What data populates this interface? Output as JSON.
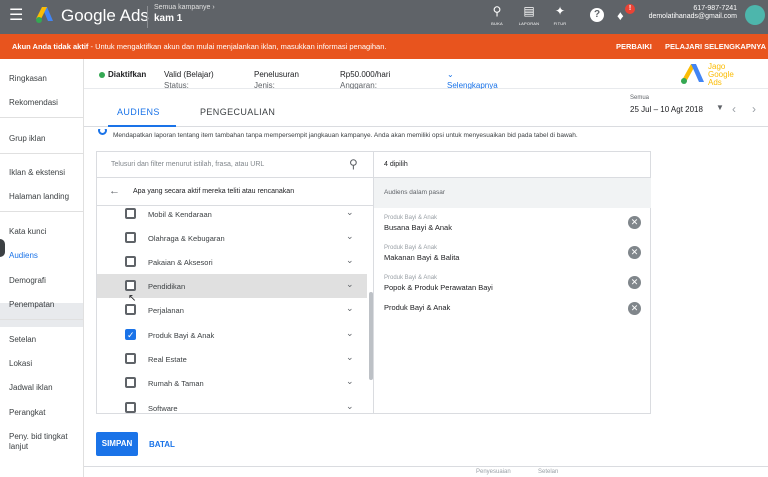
{
  "topbar": {
    "app_name": "Google Ads",
    "crumb_parent": "Semua kampanye",
    "crumb_current": "kam 1",
    "tools": [
      {
        "icon": "search-icon",
        "label": "BUKA"
      },
      {
        "icon": "bar-chart-icon",
        "label": "LAPORAN"
      },
      {
        "icon": "wrench-icon",
        "label": "FITUR"
      }
    ],
    "notif_badge": "!",
    "account_phone": "617-987-7241",
    "account_email": "demolatihanads@gmail.com"
  },
  "alert": {
    "bold": "Akun Anda tidak aktif",
    "text": " - Untuk mengaktifkan akun dan mulai menjalankan iklan, masukkan informasi penagihan.",
    "action1": "PERBAIKI",
    "action2": "PELAJARI SELENGKAPNYA",
    "color": "#e8541e"
  },
  "sidebar": {
    "items": [
      "Ringkasan",
      "Rekomendasi",
      "Grup iklan",
      "Iklan & ekstensi",
      "Halaman landing",
      "Kata kunci",
      "Audiens",
      "Demografi",
      "Penempatan",
      "Setelan",
      "Lokasi",
      "Jadwal iklan",
      "Perangkat",
      "Peny. bid tingkat lanjut"
    ],
    "active": "Audiens"
  },
  "status": {
    "state": "Diaktifkan",
    "status_label": "Status:",
    "status_value": "Valid (Belajar)",
    "type_label": "Jenis:",
    "type_value": "Penelusuran",
    "budget_label": "Anggaran:",
    "budget_value": "Rp50.000/hari",
    "more": "Selengkapnya"
  },
  "watermark": {
    "line1": "Jago",
    "line2": "Google",
    "line3": "Ads"
  },
  "tabs": [
    "AUDIENS",
    "PENGECUALIAN"
  ],
  "date": {
    "label": "Semua",
    "value": "25 Jul – 10 Agt 2018"
  },
  "description": "Mendapatkan laporan tentang item tambahan tanpa mempersempit jangkauan kampanye. Anda akan memiliki opsi untuk menyesuaikan bid pada tabel di bawah.",
  "left_panel": {
    "search_placeholder": "Telusuri dan filter menurut istilah, frasa, atau URL",
    "back_title": "Apa yang secara aktif mereka teliti atau rencanakan",
    "categories": [
      {
        "label": "Mobil & Kendaraan",
        "checked": false
      },
      {
        "label": "Olahraga & Kebugaran",
        "checked": false
      },
      {
        "label": "Pakaian & Aksesori",
        "checked": false
      },
      {
        "label": "Pendidikan",
        "checked": false
      },
      {
        "label": "Perjalanan",
        "checked": false
      },
      {
        "label": "Produk Bayi & Anak",
        "checked": true
      },
      {
        "label": "Real Estate",
        "checked": false
      },
      {
        "label": "Rumah & Taman",
        "checked": false
      },
      {
        "label": "Software",
        "checked": false
      }
    ]
  },
  "right_panel": {
    "count": "4 dipilih",
    "group": "Audiens dalam pasar",
    "selected": [
      {
        "category": "Produk Bayi & Anak",
        "name": "Busana Bayi & Anak"
      },
      {
        "category": "Produk Bayi & Anak",
        "name": "Makanan Bayi & Balita"
      },
      {
        "category": "Produk Bayi & Anak",
        "name": "Popok & Produk Perawatan Bayi"
      },
      {
        "category": "",
        "name": "Produk Bayi & Anak"
      }
    ]
  },
  "actions": {
    "save": "SIMPAN",
    "cancel": "BATAL"
  },
  "table_ghost": {
    "col1": "Penyesuaian",
    "col2": "Setelan"
  }
}
